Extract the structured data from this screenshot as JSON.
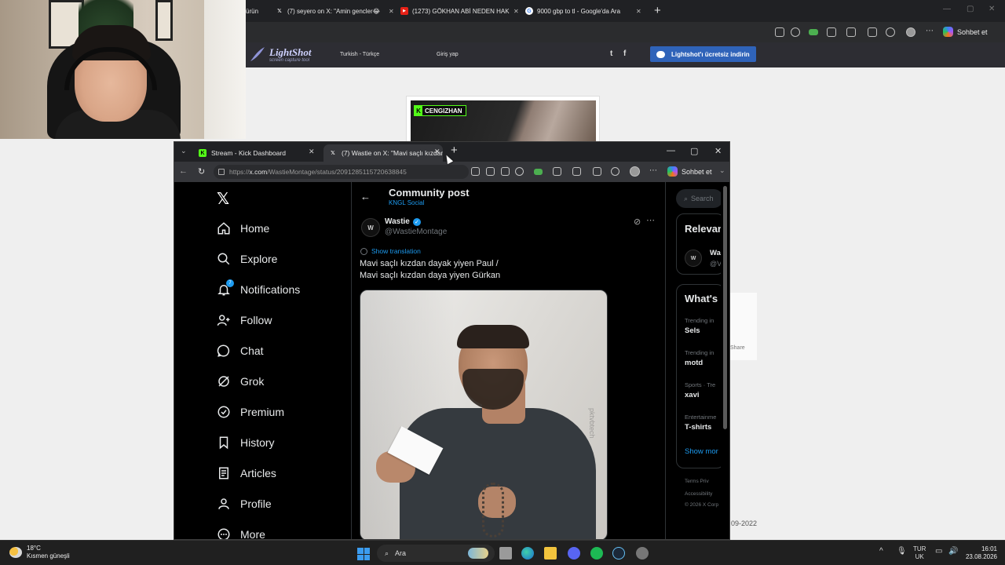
{
  "background_browser": {
    "tabs": [
      {
        "label": "ürün",
        "icon": "partial-tab-icon"
      },
      {
        "label": "(7) seyero on X: \"Amin gencler😂",
        "icon": "x-logo-icon"
      },
      {
        "label": "(1273) GÖKHAN ABİ NEDEN HAK",
        "icon": "youtube-icon"
      },
      {
        "label": "9000 gbp to tl - Google'da Ara",
        "icon": "google-icon"
      }
    ],
    "sohbet_label": "Sohbet et",
    "lightshot": {
      "logo": "LightShot",
      "tagline": "screen capture tool",
      "language": "Turkish - Türkçe",
      "login": "Giriş yap",
      "download_button": "Lightshot'ı ücretsiz indirin",
      "twitter_glyph": "t",
      "facebook_glyph": "f"
    },
    "preview_channel_tag": "CENGIZHAN",
    "share_label": "Share",
    "date_fragment": "09-2022"
  },
  "front_browser": {
    "tabs": [
      {
        "label": "Stream - Kick Dashboard",
        "icon": "kick-icon"
      },
      {
        "label": "(7) Wastie on X: \"Mavi saçlı kızdan",
        "icon": "x-logo-icon"
      }
    ],
    "url_prefix": "https://",
    "url_host": "x.com",
    "url_path": "/WastieMontage/status/2091285115720638845",
    "sohbet_label": "Sohbet et"
  },
  "x": {
    "nav": [
      {
        "label": "Home",
        "icon": "home-icon"
      },
      {
        "label": "Explore",
        "icon": "search-icon"
      },
      {
        "label": "Notifications",
        "icon": "bell-icon",
        "badge": "7"
      },
      {
        "label": "Follow",
        "icon": "person-plus-icon"
      },
      {
        "label": "Chat",
        "icon": "chat-bubble-icon"
      },
      {
        "label": "Grok",
        "icon": "grok-icon"
      },
      {
        "label": "Premium",
        "icon": "verified-badge-icon"
      },
      {
        "label": "History",
        "icon": "bookmark-icon"
      },
      {
        "label": "Articles",
        "icon": "document-icon"
      },
      {
        "label": "Profile",
        "icon": "person-icon"
      },
      {
        "label": "More",
        "icon": "more-circle-icon"
      }
    ],
    "column_title": "Community post",
    "community_name": "KNGL Social",
    "post": {
      "author_name": "Wastie",
      "author_handle": "@WastieMontage",
      "show_translation": "Show translation",
      "text_line1": "Mavi saçlı kızdan dayak yiyen Paul /",
      "text_line2": "Mavi saçlı kızdan daya yiyen Gürkan",
      "media_watermark": "pktvbtech"
    },
    "sidebar": {
      "search_placeholder": "Search",
      "relevant_title": "Relevan",
      "relevant_name": "Wa",
      "relevant_handle": "@V",
      "whats_title": "What's",
      "trends": [
        {
          "context": "Trending in",
          "name": "Sels"
        },
        {
          "context": "Trending in",
          "name": "motd"
        },
        {
          "context": "Sports · Tre",
          "name": "xavi"
        },
        {
          "context": "Entertainme",
          "name": "T-shirts"
        }
      ],
      "show_more": "Show mor",
      "footer_line1": "Terms    Priv",
      "footer_line2": "Accessibility",
      "footer_line3": "© 2026 X Corp"
    }
  },
  "taskbar": {
    "weather_temp": "18°C",
    "weather_desc": "Kısmen güneşli",
    "search_label": "Ara",
    "lang_line1": "TUR",
    "lang_line2": "UK",
    "time": "16:01",
    "date": "23.08.2026"
  }
}
